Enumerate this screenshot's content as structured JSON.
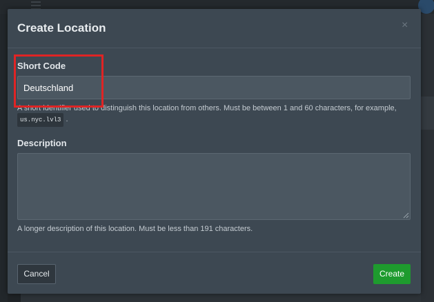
{
  "modal": {
    "title": "Create Location",
    "close_symbol": "×"
  },
  "short_code": {
    "label": "Short Code",
    "value": "Deutschland",
    "help_text": "A short identifier used to distinguish this location from others. Must be between 1 and 60 characters, for example,",
    "example_code": "us.nyc.lvl3",
    "help_suffix": "."
  },
  "description": {
    "label": "Description",
    "value": "",
    "help_text": "A longer description of this location. Must be less than 191 characters."
  },
  "footer": {
    "cancel_label": "Cancel",
    "create_label": "Create"
  },
  "colors": {
    "modal_bg": "#3d4852",
    "create_button": "#1e9b2e",
    "highlight": "#e02424"
  },
  "icons": [
    "menu-icon",
    "power-icon",
    "close-icon",
    "resize-grip-icon"
  ]
}
